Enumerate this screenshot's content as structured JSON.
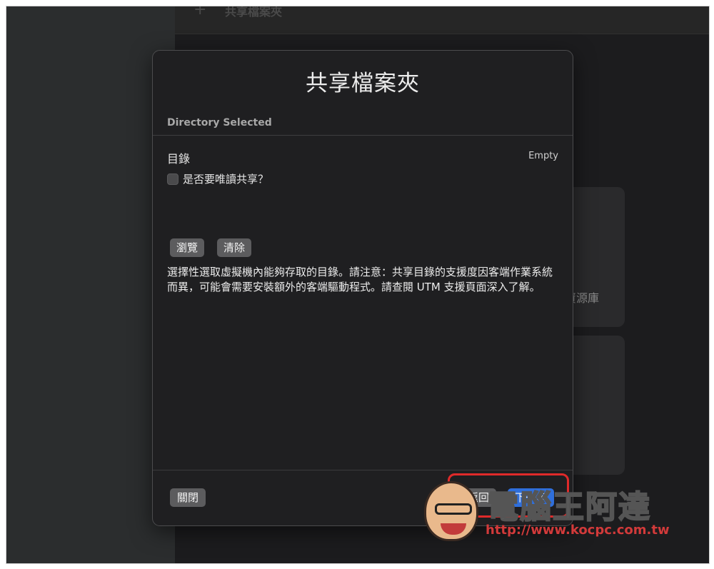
{
  "background": {
    "topbar_title": "共享檔案夾",
    "card_label": "資源庫"
  },
  "dialog": {
    "title": "共享檔案夾",
    "section_header": "Directory Selected",
    "directory_label": "目錄",
    "directory_value": "Empty",
    "readonly_label": "是否要唯讀共享？",
    "readonly_checked": false,
    "browse_label": "瀏覽",
    "clear_label": "清除",
    "description": "選擇性選取虛擬機內能夠存取的目錄。請注意：共享目錄的支援度因客端作業系統而異，可能會需要安裝額外的客端驅動程式。請查閱 UTM 支援頁面深入了解。",
    "close_label": "關閉",
    "back_label": "返回",
    "next_label": "下一步"
  },
  "watermark": {
    "title": "電腦王阿達",
    "url": "http://www.kocpc.com.tw"
  },
  "colors": {
    "accent": "#2f6fdc",
    "highlight": "#e02a2a"
  }
}
